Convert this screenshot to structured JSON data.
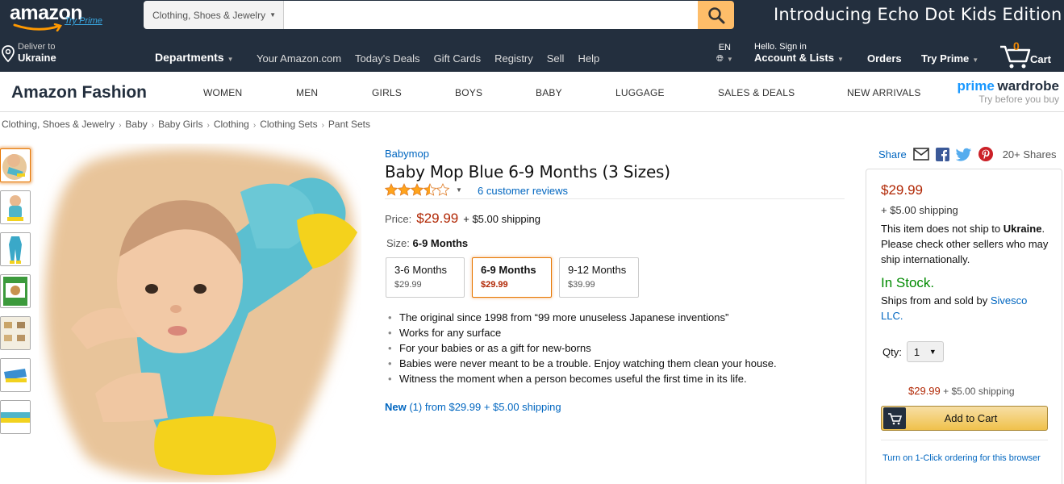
{
  "header": {
    "logo_text": "amazon",
    "logo_prime": "Try Prime",
    "search_category": "Clothing, Shoes & Jewelry",
    "search_value": "",
    "promo": "Introducing Echo Dot Kids Edition"
  },
  "nav": {
    "deliver_line1": "Deliver to",
    "deliver_line2": "Ukraine",
    "departments": "Departments",
    "links": [
      "Your Amazon.com",
      "Today's Deals",
      "Gift Cards",
      "Registry",
      "Sell",
      "Help"
    ],
    "lang": "EN",
    "account_line1": "Hello. Sign in",
    "account_line2": "Account & Lists",
    "orders": "Orders",
    "try_prime": "Try Prime",
    "cart_count": "0",
    "cart_label": "Cart"
  },
  "fashion": {
    "title": "Amazon Fashion",
    "links": [
      "WOMEN",
      "MEN",
      "GIRLS",
      "BOYS",
      "BABY",
      "LUGGAGE",
      "SALES & DEALS",
      "NEW ARRIVALS"
    ],
    "pw_prime": "prime",
    "pw_wardrobe": "wardrobe",
    "pw_tag": "Try before you buy"
  },
  "breadcrumb": [
    "Clothing, Shoes & Jewelry",
    "Baby",
    "Baby Girls",
    "Clothing",
    "Clothing Sets",
    "Pant Sets"
  ],
  "product": {
    "brand": "Babymop",
    "title": "Baby Mop Blue 6-9 Months (3 Sizes)",
    "rating": 3.5,
    "reviews": "6 customer reviews",
    "price_label": "Price:",
    "price": "$29.99",
    "shipping": "+ $5.00 shipping",
    "size_label": "Size:",
    "size_selected": "6-9 Months",
    "sizes": [
      {
        "name": "3-6 Months",
        "price": "$29.99"
      },
      {
        "name": "6-9 Months",
        "price": "$29.99"
      },
      {
        "name": "9-12 Months",
        "price": "$39.99"
      }
    ],
    "bullets": [
      "The original since 1998 from “99 more unuseless Japanese inventions”",
      "Works for any surface",
      "For your babies or as a gift for new-borns",
      "Babies were never meant to be a trouble. Enjoy watching them clean your house.",
      "Witness the moment when a person becomes useful the first time in its life."
    ],
    "new_label": "New",
    "new_rest": " (1) from $29.99 + $5.00 shipping"
  },
  "share": {
    "label": "Share",
    "count": "20+ Shares"
  },
  "buybox": {
    "price": "$29.99",
    "shipping": "+ $5.00 shipping",
    "note_pre": "This item does not ship to ",
    "note_country": "Ukraine",
    "note_post": ". Please check other sellers who may ship internationally.",
    "stock": "In Stock.",
    "sold_pre": "Ships from and sold by ",
    "seller": "Sivesco LLC.",
    "qty_label": "Qty:",
    "qty_value": "1",
    "price2": "$29.99",
    "shipping2": "+ $5.00 shipping",
    "add_to_cart": "Add to Cart",
    "one_click": "Turn on 1-Click ordering for this browser"
  },
  "colors": {
    "nav_bg": "#232f3e",
    "price_red": "#b12704",
    "link_blue": "#0066c0",
    "stock_green": "#008a00",
    "star_orange": "#ffa41c",
    "search_btn": "#febd69"
  }
}
